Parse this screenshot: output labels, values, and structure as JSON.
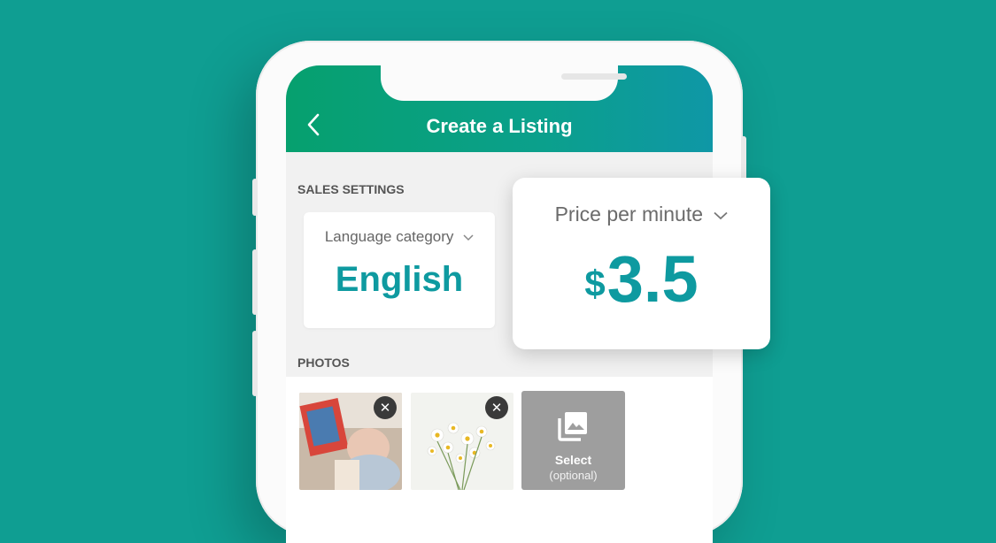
{
  "colors": {
    "background": "#0f9e92",
    "accent": "#0e9aa0",
    "header_start": "#06a06e",
    "header_end": "#0f97a6"
  },
  "header": {
    "title": "Create a  Listing",
    "back_icon": "chevron-left-icon"
  },
  "sales_settings": {
    "label": "SALES SETTINGS",
    "language": {
      "label": "Language category",
      "value": "English"
    }
  },
  "price": {
    "label": "Price per minute",
    "currency": "$",
    "value": "3.5"
  },
  "photos": {
    "label": "PHOTOS",
    "select_label": "Select",
    "select_sub": "(optional)"
  }
}
